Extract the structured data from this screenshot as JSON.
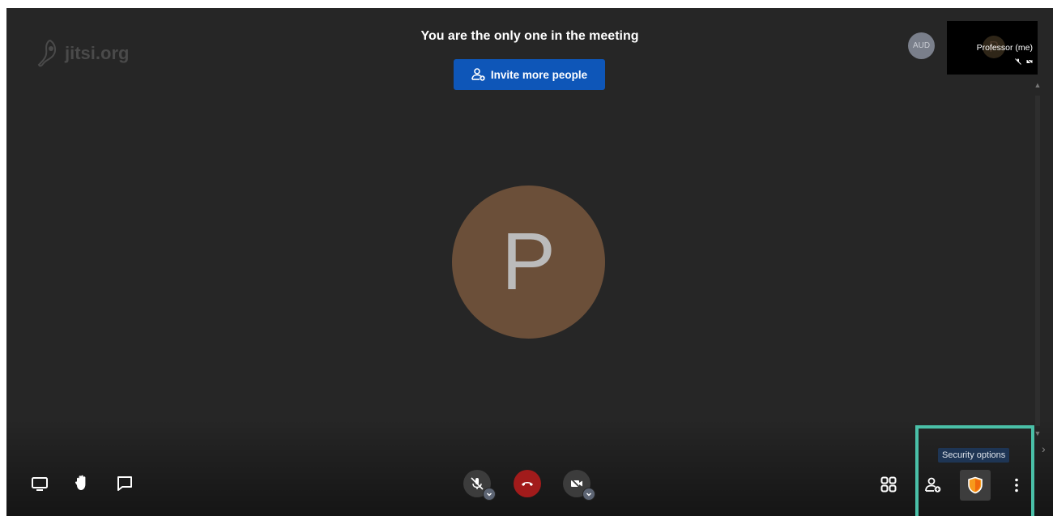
{
  "branding": {
    "logo_text": "jitsi.org"
  },
  "notice": {
    "message": "You are the only one in the meeting",
    "invite_button": "Invite more people"
  },
  "participant": {
    "initial": "P"
  },
  "filmstrip": {
    "audience_avatar": "AUD",
    "self_name": "Professor (me)"
  },
  "toolbar": {
    "security_tooltip": "Security options"
  },
  "colors": {
    "stage_bg": "#262626",
    "invite_blue": "#0e56b8",
    "avatar_brown": "#6b4f39",
    "hangup_red": "#a21b1b",
    "highlight_teal": "#4ac0a8",
    "shield_orange": "#f79a1c"
  },
  "icons": [
    "jitsi-logo-icon",
    "add-person-icon",
    "mic-off-icon",
    "camera-off-icon",
    "hangup-icon",
    "screen-share-icon",
    "raise-hand-icon",
    "chat-icon",
    "tile-view-icon",
    "invite-icon",
    "shield-icon",
    "more-options-icon"
  ]
}
